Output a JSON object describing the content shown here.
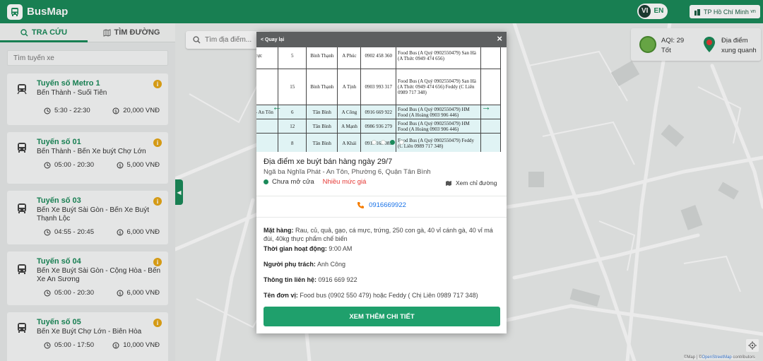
{
  "header": {
    "app_name": "BusMap",
    "lang_vi": "VI",
    "lang_en": "EN",
    "city_label": "TP Hồ Chí Minh",
    "city_suffix": "vn"
  },
  "sidebar": {
    "tab_search": "TRA CỨU",
    "tab_directions": "TÌM ĐƯỜNG",
    "route_search_placeholder": "Tìm tuyến xe",
    "routes": [
      {
        "title": "Tuyến số Metro 1",
        "desc": "Bến Thành - Suối Tiên",
        "hours": "5:30 - 22:30",
        "fare": "20,000 VNĐ"
      },
      {
        "title": "Tuyến số 01",
        "desc": "Bến Thành - Bến Xe buýt Chợ Lớn",
        "hours": "05:00 - 20:30",
        "fare": "5,000 VNĐ"
      },
      {
        "title": "Tuyến số 03",
        "desc": "Bến Xe Buýt Sài Gòn - Bến Xe Buýt Thạnh Lộc",
        "hours": "04:55 - 20:45",
        "fare": "6,000 VNĐ"
      },
      {
        "title": "Tuyến số 04",
        "desc": "Bến Xe Buýt Sài Gòn - Cộng Hòa - Bến Xe An Sương",
        "hours": "05:00 - 20:30",
        "fare": "6,000 VNĐ"
      },
      {
        "title": "Tuyến số 05",
        "desc": "Bến Xe Buýt Chợ Lớn - Biên Hòa",
        "hours": "05:00 - 17:50",
        "fare": "10,000 VNĐ"
      }
    ]
  },
  "map": {
    "search_placeholder": "Tìm địa điểm...",
    "aqi_label": "AQI: 29",
    "aqi_status": "Tốt",
    "nearby_line1": "Địa điểm",
    "nearby_line2": "xung quanh",
    "attribution_prefix": "©Map | ©",
    "attribution_osm": "OpenStreetMap",
    "attribution_suffix": " contributors"
  },
  "modal": {
    "back_label": "< Quay lại",
    "close_label": "×",
    "photo_table": [
      {
        "c0": "Trực",
        "c1": "5",
        "c2": "Bình Thạnh",
        "c3": "A Phúc",
        "c4": "0902 458 360",
        "c5": "Food Bus (A Quý 0902550479) San Hà (A Thức 0949 474 656)",
        "hl": false
      },
      {
        "c0": "",
        "c1": "15",
        "c2": "Bình Thạnh",
        "c3": "A Tịnh",
        "c4": "0903 993 317",
        "c5": "Food Bus (A Quý 0902550479) San Hà (A Thức 0949 474 656) Feddy (C Liên 0989 717 348)",
        "hl": false
      },
      {
        "c0": "t - An Tôn",
        "c1": "6",
        "c2": "Tân Bình",
        "c3": "A Công",
        "c4": "0916 669 922",
        "c5": "Food Bus (A Quý 0902550479) HM Food (A Hoàng 0903 906 446)",
        "hl": true
      },
      {
        "c0": "",
        "c1": "12",
        "c2": "Tân Bình",
        "c3": "A Mạnh",
        "c4": "0986 936 279",
        "c5": "Food Bus (A Quý 0902550479) HM Food (A Hoàng 0903 906 446)",
        "hl": true
      },
      {
        "c0": "",
        "c1": "8",
        "c2": "Tân Bình",
        "c3": "A Khải",
        "c4": "0913 163 083",
        "c5": "Food Bus (A Quý 0902550479) Feddy (C Liên 0989 717 348)",
        "hl": true
      }
    ],
    "title": "Địa điểm xe buýt bán hàng ngày 29/7",
    "address": "Ngã ba Nghĩa Phát - An Tôn, Phường 6, Quận Tân Bình",
    "status_open": "Chưa mở cửa",
    "price_level": "Nhiều mức giá",
    "directions_label": "Xem chỉ đường",
    "phone": "0916669922",
    "goods_label": "Mặt hàng:",
    "goods_value": "Rau, củ, quả, gạo, cá mực, trứng, 250 con gà, 40 vỉ cánh gà, 40 vỉ má đùi, 40kg thực phẩm chế biến",
    "hours_label": "Thời gian hoạt động:",
    "hours_value": "9:00 AM",
    "person_label": "Người phụ trách:",
    "person_value": "Anh Công",
    "contact_label": "Thông tin liên hệ:",
    "contact_value": "0916 669 922",
    "unit_label": "Tên đơn vị:",
    "unit_value": "Food bus (0902 550 479) hoặc Feddy ( Chị Liên 0989 717 348)",
    "cta_label": "XEM THÊM CHI TIẾT"
  },
  "colors": {
    "brand_green": "#1b8a5a",
    "price_red": "#e53935",
    "phone_blue": "#1a73e8",
    "info_orange": "#e6a817"
  }
}
